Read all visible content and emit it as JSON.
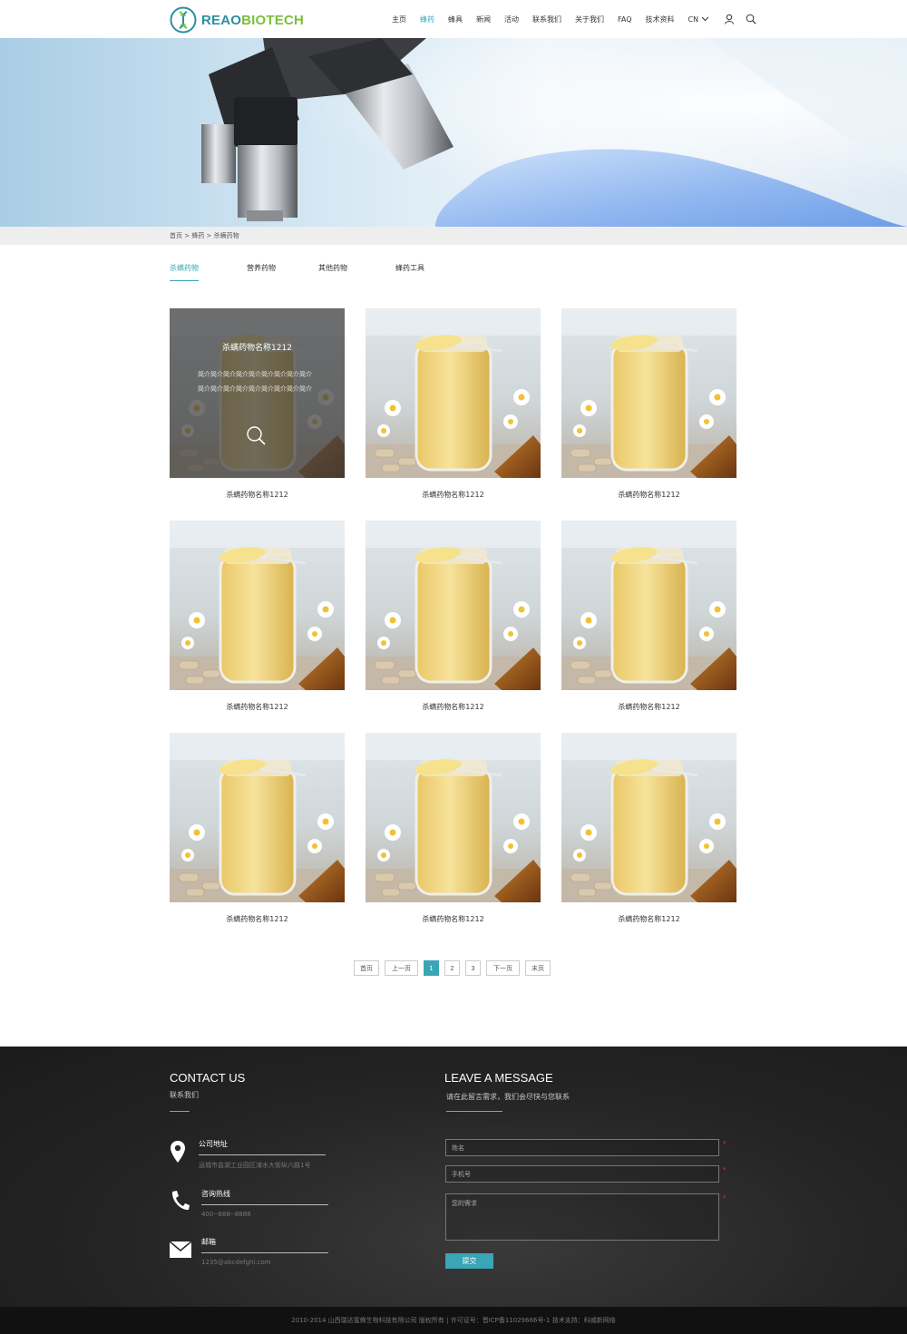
{
  "header": {
    "logo_part1": "REAO",
    "logo_part2": "BIOTECH",
    "nav": [
      "主页",
      "蜂药",
      "蜂具",
      "新闻",
      "活动",
      "联系我们",
      "关于我们",
      "FAQ",
      "技术资料"
    ],
    "active_nav_index": 1,
    "lang": "CN"
  },
  "breadcrumb": "首页 > 蜂药 > 杀螨药物",
  "tabs": [
    "杀螨药物",
    "营养药物",
    "其他药物",
    "蜂药工具"
  ],
  "active_tab_index": 0,
  "products": [
    {
      "name": "杀螨药物名称1212"
    },
    {
      "name": "杀螨药物名称1212"
    },
    {
      "name": "杀螨药物名称1212"
    },
    {
      "name": "杀螨药物名称1212"
    },
    {
      "name": "杀螨药物名称1212"
    },
    {
      "name": "杀螨药物名称1212"
    },
    {
      "name": "杀螨药物名称1212"
    },
    {
      "name": "杀螨药物名称1212"
    },
    {
      "name": "杀螨药物名称1212"
    }
  ],
  "hover_card": {
    "title": "杀螨药物名称1212",
    "desc": "简介简介简介简介简介简介简介简介简介简介简介简介简介简介简介简介简介简介"
  },
  "pagination": {
    "first": "首页",
    "prev": "上一页",
    "pages": [
      "1",
      "2",
      "3"
    ],
    "current": "1",
    "next": "下一页",
    "last": "末页"
  },
  "footer": {
    "contact_title": "CONTACT US",
    "contact_sub": "联系我们",
    "address_label": "公司地址",
    "address_value": "运城市盐湖工业园区涑水大街纵六路1号",
    "phone_label": "咨询热线",
    "phone_value": "400--888--8888",
    "email_label": "邮箱",
    "email_value": "1235@abcdefghi.com",
    "message_title": "LEAVE A MESSAGE",
    "message_sub": "请在此留言需求，我们会尽快与您联系",
    "name_placeholder": "姓名",
    "phone_placeholder": "手机号",
    "need_placeholder": "您的需求",
    "required_mark": "*",
    "submit_label": "提交",
    "copyright": "2010-2014 山西瑞达蜜蜂生物科技有限公司 版权所有 | 许可证号：晋ICP备11029666号-1   技术支持：科威新网络"
  },
  "colors": {
    "accent": "#3aa5b4",
    "logo_green": "#7bbf3a",
    "footer_bg": "#242424"
  }
}
